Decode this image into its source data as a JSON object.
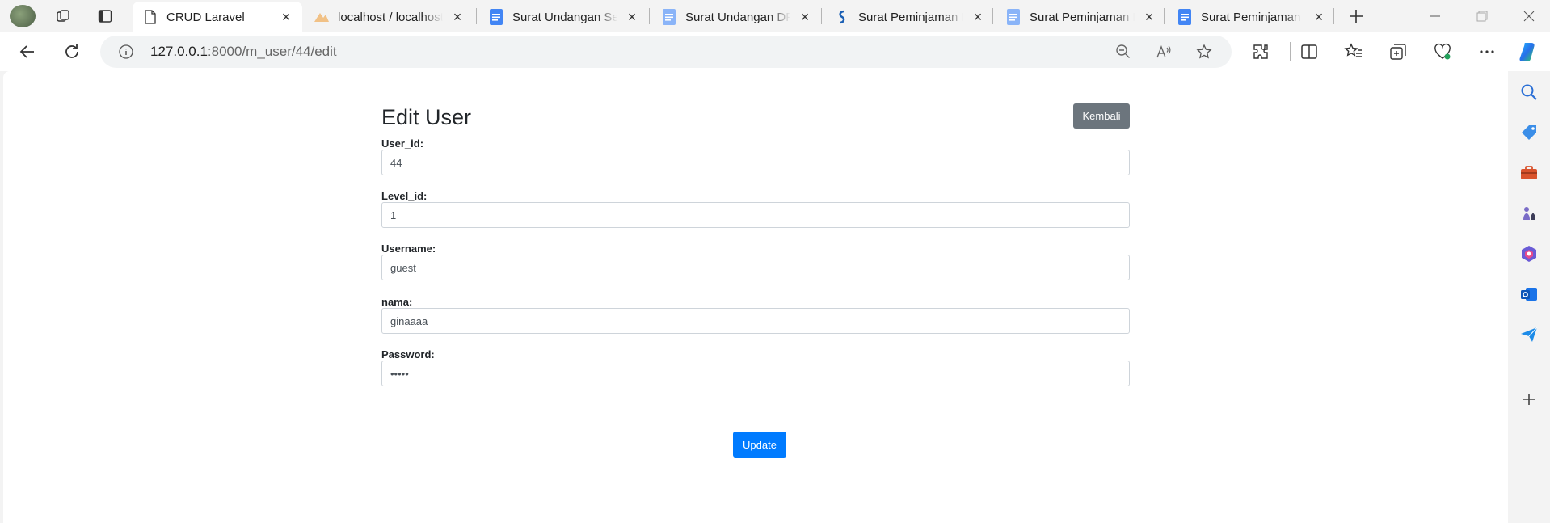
{
  "browser": {
    "tabs": [
      {
        "title": "CRUD Laravel",
        "favicon": "page-icon",
        "active": true
      },
      {
        "title": "localhost / localhost",
        "favicon": "phpmyadmin-icon",
        "active": false
      },
      {
        "title": "Surat Undangan Seminar",
        "favicon": "docs-icon",
        "active": false
      },
      {
        "title": "Surat Undangan DPR",
        "favicon": "docs-icon",
        "active": false
      },
      {
        "title": "Surat Peminjaman Barang",
        "favicon": "blue-s-icon",
        "active": false
      },
      {
        "title": "Surat Peminjaman Barang",
        "favicon": "docs-icon",
        "active": false
      },
      {
        "title": "Surat Peminjaman Barang",
        "favicon": "docs-icon",
        "active": false
      }
    ],
    "address": {
      "host": "127.0.0.1",
      "path": ":8000/m_user/44/edit"
    },
    "colors": {
      "chrome_bg": "#f3f3f3",
      "docs_blue": "#4285f4"
    }
  },
  "page": {
    "title": "Edit User",
    "back_label": "Kembali",
    "fields": [
      {
        "label": "User_id:",
        "value": "44",
        "type": "text"
      },
      {
        "label": "Level_id:",
        "value": "1",
        "type": "text"
      },
      {
        "label": "Username:",
        "value": "guest",
        "type": "text"
      },
      {
        "label": "nama:",
        "value": "ginaaaa",
        "type": "text"
      },
      {
        "label": "Password:",
        "value": "•••••",
        "type": "password"
      }
    ],
    "submit_label": "Update",
    "colors": {
      "primary": "#007bff",
      "secondary": "#6c757d"
    }
  },
  "sidebar": {
    "icons": [
      "search-icon",
      "tag-icon",
      "toolbox-icon",
      "chess-icon",
      "m365-icon",
      "outlook-icon",
      "send-icon",
      "add-icon"
    ]
  }
}
